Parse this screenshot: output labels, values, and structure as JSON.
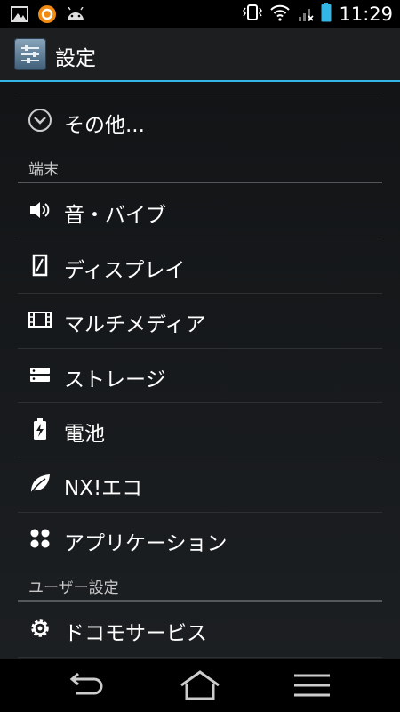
{
  "status": {
    "time": "11:29"
  },
  "header": {
    "title": "設定"
  },
  "more": {
    "label": "その他..."
  },
  "sections": [
    {
      "title": "端末",
      "items": [
        {
          "label": "音・バイブ",
          "icon": "volume-icon"
        },
        {
          "label": "ディスプレイ",
          "icon": "display-icon"
        },
        {
          "label": "マルチメディア",
          "icon": "film-icon"
        },
        {
          "label": "ストレージ",
          "icon": "storage-icon"
        },
        {
          "label": "電池",
          "icon": "battery-icon"
        },
        {
          "label": "NX!エコ",
          "icon": "leaf-icon"
        },
        {
          "label": "アプリケーション",
          "icon": "apps-icon"
        }
      ]
    },
    {
      "title": "ユーザー設定",
      "items": [
        {
          "label": "ドコモサービス",
          "icon": "gear-icon"
        }
      ]
    }
  ],
  "colors": {
    "accent": "#33b5e5",
    "background": "#16181a"
  }
}
